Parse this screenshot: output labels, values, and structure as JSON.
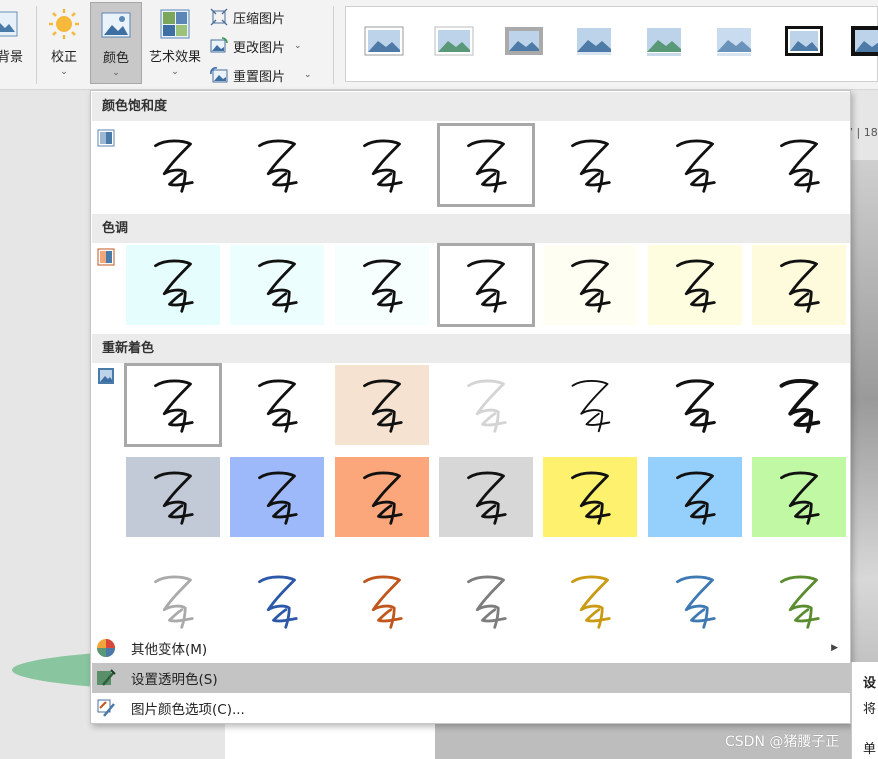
{
  "ribbon": {
    "buttons": [
      {
        "label": "背景"
      },
      {
        "label": "校正"
      },
      {
        "label": "颜色"
      },
      {
        "label": "艺术效果"
      }
    ],
    "small_buttons": [
      {
        "label": "压缩图片"
      },
      {
        "label": "更改图片"
      },
      {
        "label": "重置图片"
      }
    ]
  },
  "ruler_text": "7 | 18",
  "panel": {
    "sections": [
      {
        "title": "颜色饱和度"
      },
      {
        "title": "色调"
      },
      {
        "title": "重新着色"
      }
    ],
    "menu": [
      {
        "label": "其他变体(M)"
      },
      {
        "label": "设置透明色(S)"
      },
      {
        "label": "图片颜色选项(C)..."
      }
    ]
  },
  "tooltip_chars": [
    "设",
    "将",
    "单"
  ],
  "watermark": "CSDN @猪腰子正",
  "colors": {
    "tint": [
      "#e6fdfd",
      "#edfefe",
      "#f7fefe",
      "#ffffff",
      "#fefef2",
      "#fefde0",
      "#fefadc"
    ],
    "recolor_row1": [
      "#ffffff",
      "#ffffff",
      "#f5e2d0",
      "#ffffff",
      "#ffffff",
      "#ffffff",
      "#ffffff"
    ],
    "recolor_row2": [
      "#c2c9d7",
      "#9db9f9",
      "#fca67c",
      "#d7d7d7",
      "#fdf16e",
      "#95cffb",
      "#c1f8a4"
    ],
    "recolor_row3_stroke": [
      "#aaaaaa",
      "#2d57a8",
      "#c0561c",
      "#7d7d7d",
      "#c99a12",
      "#3f79b3",
      "#5a8d2f"
    ]
  }
}
